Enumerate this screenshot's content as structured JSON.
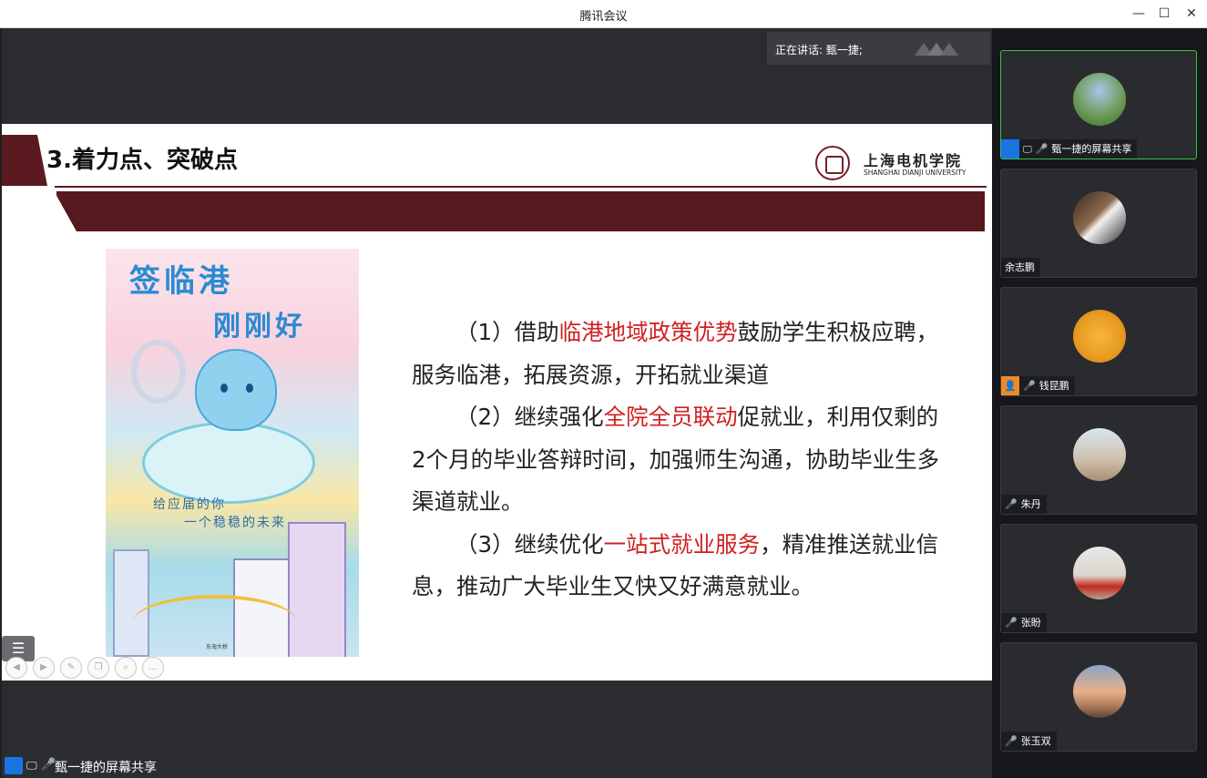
{
  "window": {
    "title": "腾讯会议"
  },
  "speaker": {
    "text": "正在讲话: 甄一捷;"
  },
  "slide": {
    "title": "3.着力点、突破点",
    "university_cn": "上海电机学院",
    "university_en": "SHANGHAI DIANJI UNIVERSITY",
    "poster": {
      "line1": "签临港",
      "line2": "刚刚好",
      "hand1": "给应届的你",
      "hand2": "一个稳稳的未来",
      "plate": "东海大桥"
    },
    "paragraphs": [
      {
        "pre": "（1）借助",
        "red": "临港地域政策优势",
        "post": "鼓励学生积极应聘，服务临港，拓展资源，开拓就业渠道"
      },
      {
        "pre": "（2）继续强化",
        "red": "全院全员联动",
        "post": "促就业，利用仅剩的2个月的毕业答辩时间，加强师生沟通，协助毕业生多渠道就业。"
      },
      {
        "pre": "（3）继续优化",
        "red": "一站式就业服务",
        "post": "，精准推送就业信息，推动广大毕业生又快又好满意就业。"
      }
    ]
  },
  "share_badge": {
    "label": "甄一捷的屏幕共享"
  },
  "participants": [
    {
      "name": "甄一捷的屏幕共享",
      "active": true,
      "host": true,
      "sharing": true,
      "mic": "on",
      "avatar": "landscape-photo"
    },
    {
      "name": "余志鹏",
      "mic": "none",
      "avatar": "piano-photo"
    },
    {
      "name": "钱昆鹏",
      "host_orange": true,
      "mic": "off",
      "avatar": "cartoon-face"
    },
    {
      "name": "朱丹",
      "mic": "off",
      "avatar": "portrait-photo"
    },
    {
      "name": "张盼",
      "mic": "off",
      "avatar": "red-dress-photo"
    },
    {
      "name": "张玉双",
      "mic": "off",
      "avatar": "sunset-photo"
    }
  ],
  "colors": {
    "accent": "#55191e",
    "highlight": "#d02020",
    "active_border": "#35c248",
    "host_blue": "#1a73e8"
  }
}
